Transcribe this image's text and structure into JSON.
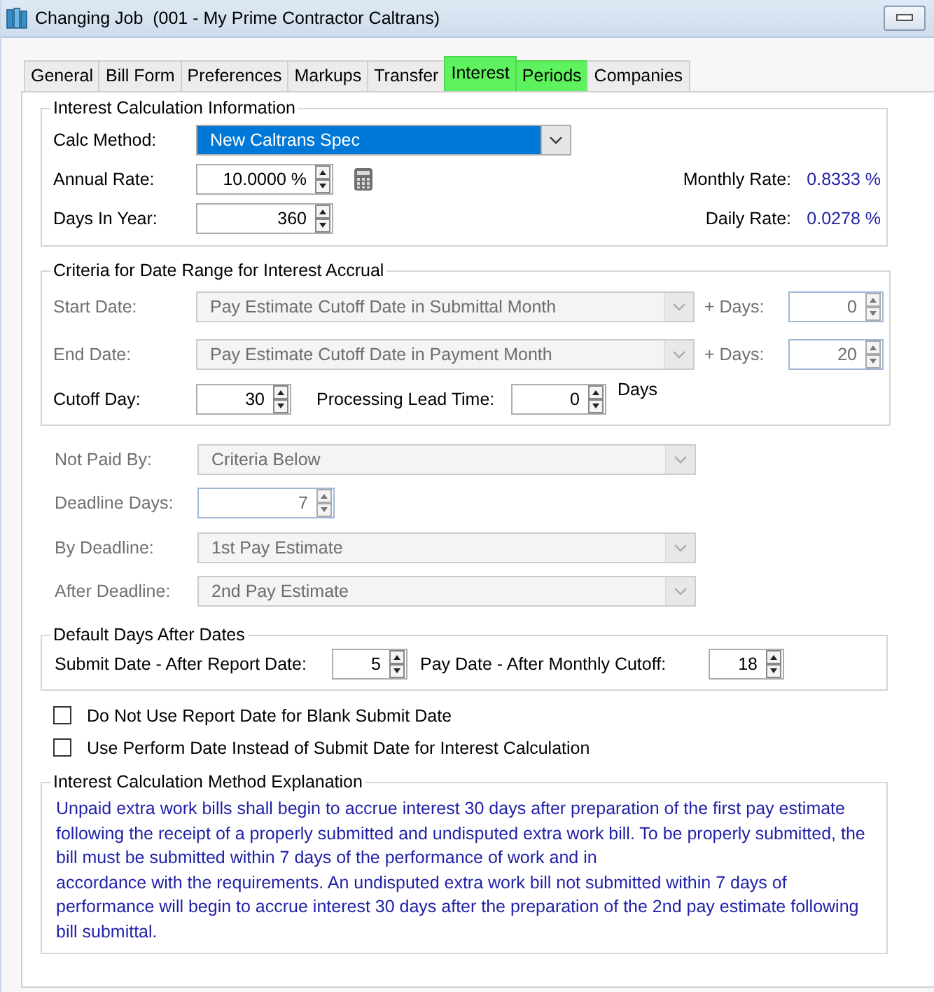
{
  "window": {
    "title": "Changing Job  (001 - My Prime Contractor Caltrans)"
  },
  "tabs": [
    {
      "label": "General",
      "selected": false,
      "highlighted": false
    },
    {
      "label": "Bill Form",
      "selected": false,
      "highlighted": false
    },
    {
      "label": "Preferences",
      "selected": false,
      "highlighted": false
    },
    {
      "label": "Markups",
      "selected": false,
      "highlighted": false
    },
    {
      "label": "Transfer",
      "selected": false,
      "highlighted": false
    },
    {
      "label": "Interest",
      "selected": true,
      "highlighted": true
    },
    {
      "label": "Periods",
      "selected": false,
      "highlighted": true
    },
    {
      "label": "Companies",
      "selected": false,
      "highlighted": false
    }
  ],
  "interest_info": {
    "title": "Interest Calculation Information",
    "calc_method": {
      "label": "Calc Method:",
      "value": "New Caltrans Spec"
    },
    "annual_rate": {
      "label": "Annual Rate:",
      "value": "10.0000 %"
    },
    "days_in_year": {
      "label": "Days In Year:",
      "value": "360"
    },
    "monthly_rate": {
      "label": "Monthly Rate:",
      "value": "0.8333 %"
    },
    "daily_rate": {
      "label": "Daily Rate:",
      "value": "0.0278 %"
    }
  },
  "criteria": {
    "title": "Criteria for Date Range for Interest Accrual",
    "dates": [
      {
        "label": "Start Date:",
        "value": "Pay Estimate Cutoff Date in Submittal Month",
        "disabled": true,
        "days_label": "+ Days:",
        "days": "0"
      },
      {
        "label": "End Date:",
        "value": "Pay Estimate Cutoff Date in Payment Month",
        "disabled": true,
        "days_label": "+ Days:",
        "days": "20"
      }
    ],
    "cutoff_day": {
      "label": "Cutoff Day:",
      "value": "30"
    },
    "lead_time": {
      "label": "Processing Lead Time:",
      "value": "0",
      "unit": "Days"
    }
  },
  "deadline_rows": [
    {
      "kind": "combo",
      "label": "Not Paid By:",
      "value": "Criteria Below",
      "disabled": true
    },
    {
      "kind": "spin",
      "label": "Deadline Days:",
      "value": "7",
      "disabled": true
    },
    {
      "kind": "combo",
      "label": "By Deadline:",
      "value": "1st Pay Estimate",
      "disabled": true
    },
    {
      "kind": "combo",
      "label": "After Deadline:",
      "value": "2nd Pay Estimate",
      "disabled": true
    }
  ],
  "default_days": {
    "title": "Default Days After Dates",
    "submit": {
      "label": "Submit Date - After Report Date:",
      "value": "5"
    },
    "pay": {
      "label": "Pay Date - After Monthly Cutoff:",
      "value": "18"
    }
  },
  "checkboxes": [
    {
      "label": "Do Not Use Report Date for Blank Submit Date",
      "checked": false
    },
    {
      "label": "Use Perform Date Instead of Submit Date for Interest Calculation",
      "checked": false
    }
  ],
  "explanation": {
    "title": "Interest Calculation Method Explanation",
    "text": "Unpaid extra work bills shall begin to accrue interest 30 days after preparation of the first pay estimate following the receipt of a properly submitted and undisputed extra work bill. To be properly submitted, the bill must be submitted within 7 days of the performance of work and in\naccordance with the requirements. An undisputed extra work bill not submitted within 7 days of performance will begin to accrue interest 30 days after the preparation of the 2nd pay estimate following bill submittal."
  }
}
